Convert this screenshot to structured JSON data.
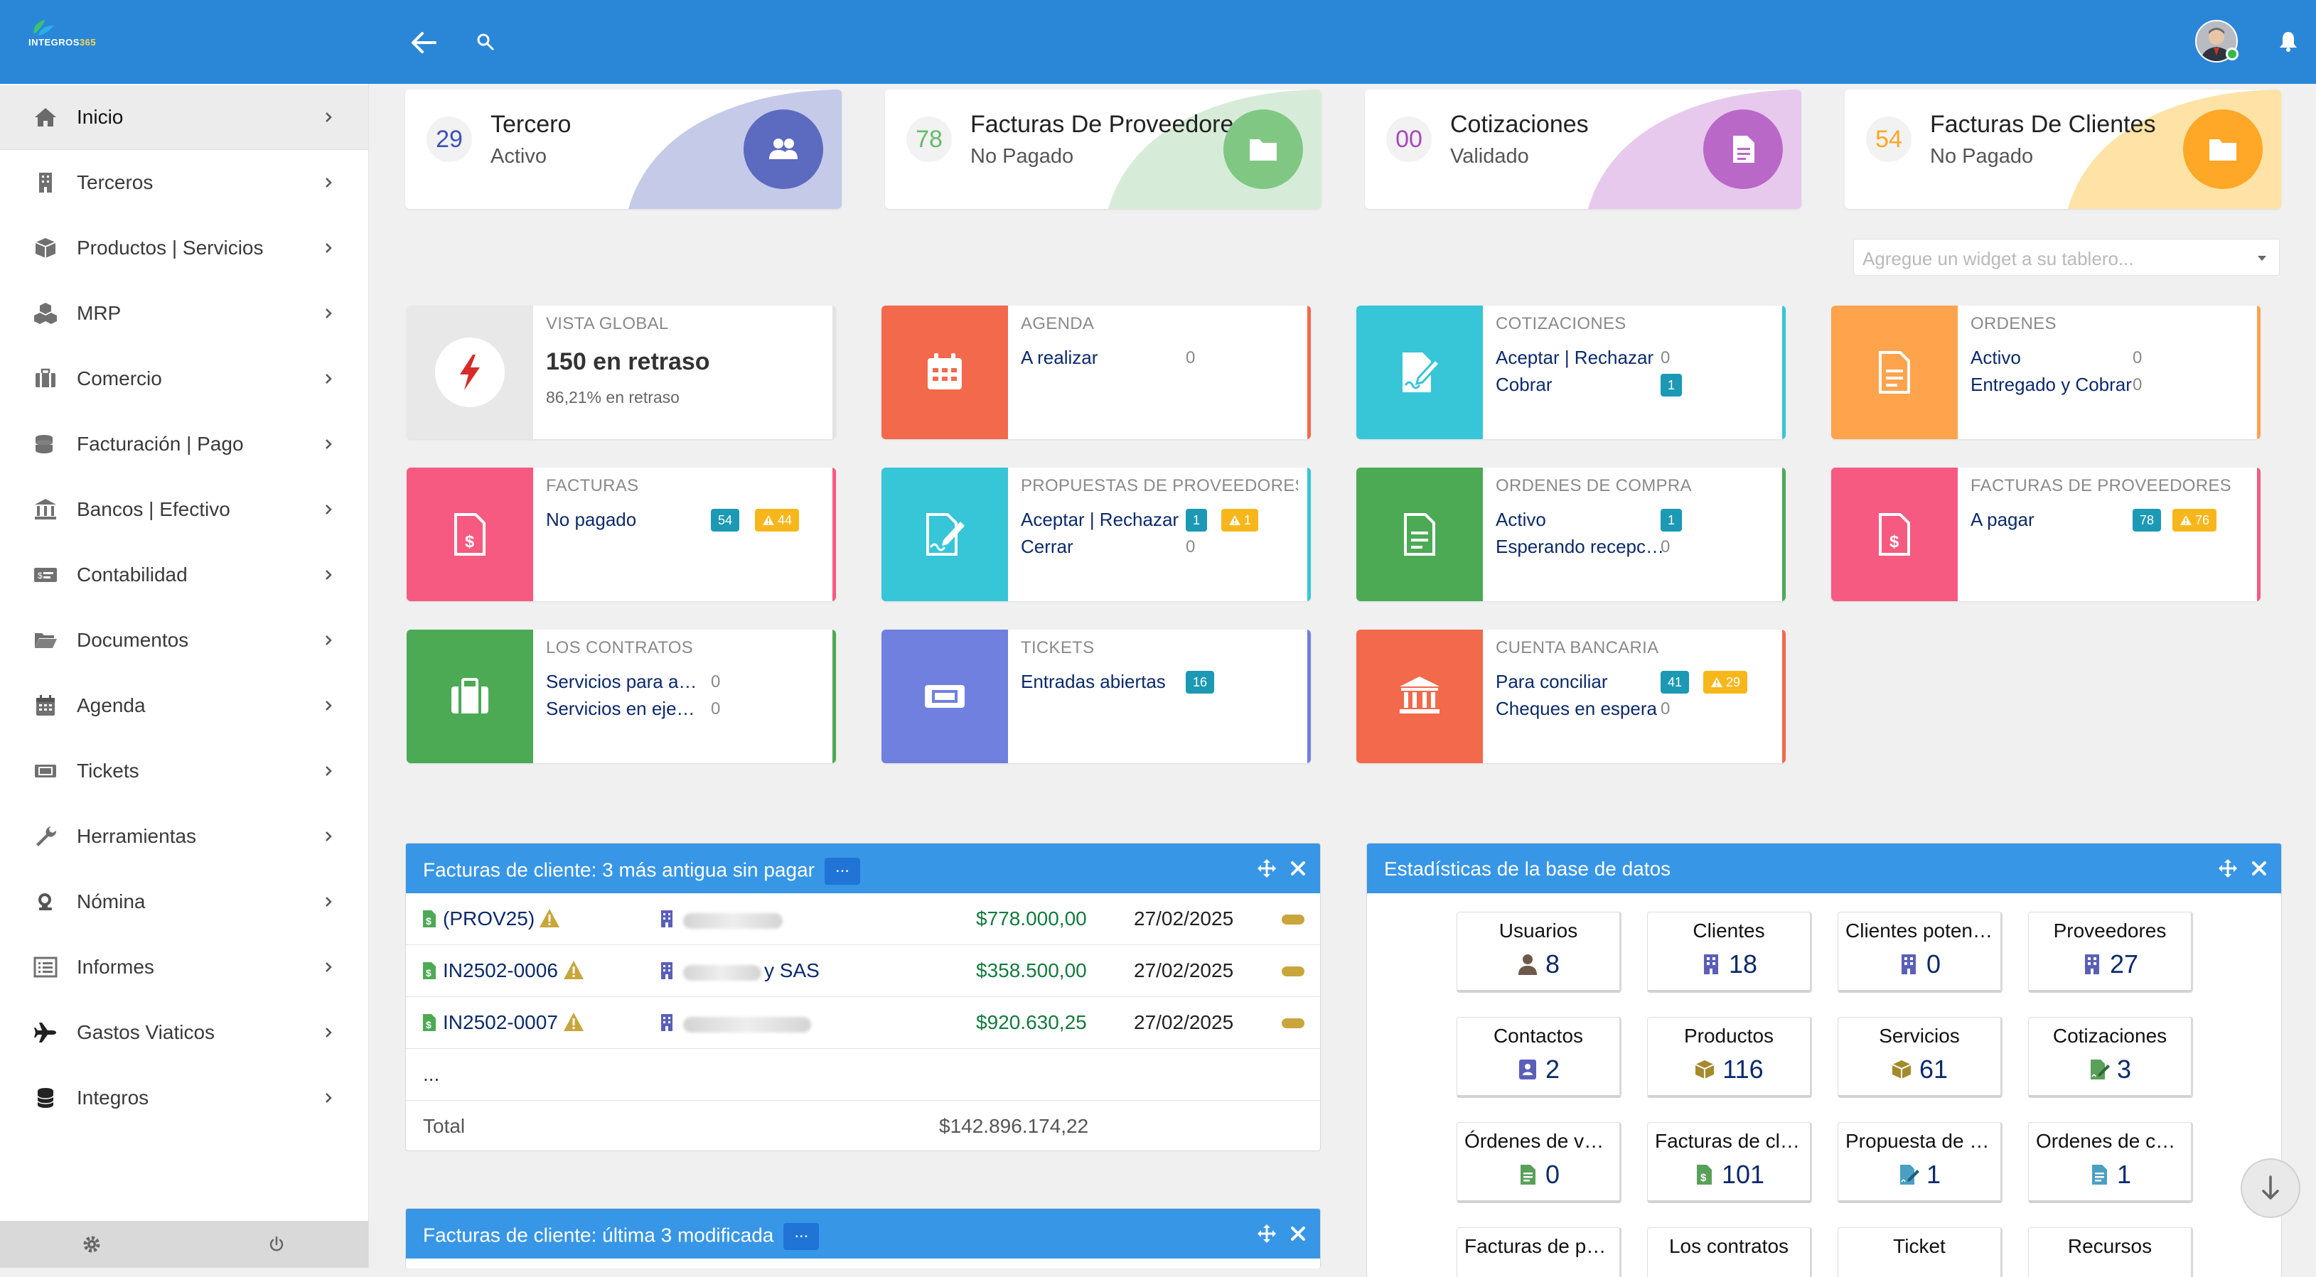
{
  "app": {
    "logo_text": "INTEGROS",
    "logo_suffix": "365"
  },
  "sidebar": {
    "items": [
      {
        "label": "Inicio",
        "icon": "home-icon"
      },
      {
        "label": "Terceros",
        "icon": "building-icon"
      },
      {
        "label": "Productos | Servicios",
        "icon": "cube-icon"
      },
      {
        "label": "MRP",
        "icon": "cubes-icon"
      },
      {
        "label": "Comercio",
        "icon": "suitcase-icon"
      },
      {
        "label": "Facturación | Pago",
        "icon": "coins-icon"
      },
      {
        "label": "Bancos | Efectivo",
        "icon": "bank-icon"
      },
      {
        "label": "Contabilidad",
        "icon": "money-check-icon"
      },
      {
        "label": "Documentos",
        "icon": "folder-open-icon"
      },
      {
        "label": "Agenda",
        "icon": "calendar-icon"
      },
      {
        "label": "Tickets",
        "icon": "ticket-icon"
      },
      {
        "label": "Herramientas",
        "icon": "wrench-icon"
      },
      {
        "label": "Nómina",
        "icon": "piggy-bank-icon"
      },
      {
        "label": "Informes",
        "icon": "list-icon"
      },
      {
        "label": "Gastos Viaticos",
        "icon": "plane-icon"
      },
      {
        "label": "Integros",
        "icon": "database-icon"
      }
    ]
  },
  "kpis": [
    {
      "number": "29",
      "title": "Tercero",
      "subtitle": "Activo",
      "color": "#5c6bc0",
      "wave": "#c5cae9",
      "numcolor": "#3f51b5"
    },
    {
      "number": "78",
      "title": "Facturas De Proveedores",
      "subtitle": "No Pagado",
      "color": "#81c784",
      "wave": "#d7ecd8",
      "numcolor": "#66bb6a"
    },
    {
      "number": "00",
      "title": "Cotizaciones",
      "subtitle": "Validado",
      "color": "#ba68c8",
      "wave": "#e8c9ee",
      "numcolor": "#ab47bc"
    },
    {
      "number": "54",
      "title": "Facturas De Clientes",
      "subtitle": "No Pagado",
      "color": "#ffa726",
      "wave": "#ffe3a6",
      "numcolor": "#ffa726"
    }
  ],
  "widget_select": {
    "placeholder": "Agregue un widget a su tablero..."
  },
  "boxes": {
    "global": {
      "title": "VISTA GLOBAL",
      "big": "150 en retraso",
      "sub": "86,21% en retraso"
    },
    "agenda": {
      "title": "AGENDA",
      "lines": [
        {
          "label": "A realizar",
          "count": "0"
        }
      ]
    },
    "cotizaciones": {
      "title": "COTIZACIONES",
      "lines": [
        {
          "label": "Aceptar | Rechazar",
          "count": "0"
        },
        {
          "label": "Cobrar",
          "badge": "1"
        }
      ]
    },
    "ordenes": {
      "title": "ORDENES",
      "lines": [
        {
          "label": "Activo",
          "count": "0"
        },
        {
          "label": "Entregado y Cobrar",
          "count": "0"
        }
      ]
    },
    "facturas": {
      "title": "FACTURAS",
      "lines": [
        {
          "label": "No pagado",
          "badge": "54",
          "warn": "44"
        }
      ]
    },
    "propuestas": {
      "title": "PROPUESTAS DE PROVEEDORES",
      "lines": [
        {
          "label": "Aceptar | Rechazar",
          "badge": "1",
          "warn": "1"
        },
        {
          "label": "Cerrar",
          "count": "0"
        }
      ]
    },
    "ordenes_compra": {
      "title": "ORDENES DE COMPRA",
      "lines": [
        {
          "label": "Activo",
          "badge": "1"
        },
        {
          "label": "Esperando recepción",
          "count": "0"
        }
      ]
    },
    "facturas_prov": {
      "title": "FACTURAS DE PROVEEDORES",
      "lines": [
        {
          "label": "A pagar",
          "badge": "78",
          "warn": "76"
        }
      ]
    },
    "contratos": {
      "title": "LOS CONTRATOS",
      "lines": [
        {
          "label": "Servicios para activar",
          "count": "0"
        },
        {
          "label": "Servicios en ejecución",
          "count": "0"
        }
      ]
    },
    "tickets": {
      "title": "TICKETS",
      "lines": [
        {
          "label": "Entradas abiertas",
          "badge": "16"
        }
      ]
    },
    "cuenta": {
      "title": "CUENTA BANCARIA",
      "lines": [
        {
          "label": "Para conciliar",
          "badge": "41",
          "warn": "29"
        },
        {
          "label": "Cheques en espera",
          "count": "0"
        }
      ]
    }
  },
  "invoices_panel": {
    "title": "Facturas de cliente: 3 más antigua sin pagar",
    "more": "...",
    "rows": [
      {
        "ref": "(PROV25)",
        "amount": "$778.000,00",
        "date": "27/02/2025"
      },
      {
        "ref": "IN2502-0006",
        "client_tail": "y SAS",
        "amount": "$358.500,00",
        "date": "27/02/2025"
      },
      {
        "ref": "IN2502-0007",
        "amount": "$920.630,25",
        "date": "27/02/2025"
      }
    ],
    "ellipsis": "...",
    "total_label": "Total",
    "total_value": "$142.896.174,22"
  },
  "modified_panel": {
    "title": "Facturas de cliente: última 3 modificada",
    "more": "..."
  },
  "stats_panel": {
    "title": "Estadísticas de la base de datos",
    "items": [
      {
        "label": "Usuarios",
        "value": "8",
        "icon": "user-icon",
        "color": "#6d5a49"
      },
      {
        "label": "Clientes",
        "value": "18",
        "icon": "building-icon",
        "color": "#5a5fb8"
      },
      {
        "label": "Clientes potenciales",
        "value": "0",
        "icon": "building-icon",
        "color": "#5a5fb8"
      },
      {
        "label": "Proveedores",
        "value": "27",
        "icon": "building-icon",
        "color": "#5a5fb8"
      },
      {
        "label": "Contactos",
        "value": "2",
        "icon": "address-book-icon",
        "color": "#5a5fb8"
      },
      {
        "label": "Productos",
        "value": "116",
        "icon": "cube-icon",
        "color": "#a58a2c"
      },
      {
        "label": "Servicios",
        "value": "61",
        "icon": "cube-icon",
        "color": "#a58a2c"
      },
      {
        "label": "Cotizaciones",
        "value": "3",
        "icon": "file-signature-icon",
        "color": "#5aa05a"
      },
      {
        "label": "Órdenes de venta",
        "value": "0",
        "icon": "file-text-icon",
        "color": "#5aa05a"
      },
      {
        "label": "Facturas de clientes",
        "value": "101",
        "icon": "file-invoice-icon",
        "color": "#5aa05a"
      },
      {
        "label": "Propuesta de proveedores",
        "value": "1",
        "icon": "file-signature-icon",
        "color": "#4a9fc2"
      },
      {
        "label": "Ordenes de compra",
        "value": "1",
        "icon": "file-text-icon",
        "color": "#4a9fc2"
      },
      {
        "label": "Facturas de proveedores",
        "value": "",
        "icon": "",
        "color": ""
      },
      {
        "label": "Los contratos",
        "value": "",
        "icon": "",
        "color": ""
      },
      {
        "label": "Ticket",
        "value": "",
        "icon": "",
        "color": ""
      },
      {
        "label": "Recursos",
        "value": "",
        "icon": "",
        "color": ""
      }
    ]
  },
  "colors": {
    "topbar": "#2a87d8",
    "panel_head": "#3796e6",
    "agenda": "#f2694c",
    "cotizaciones": "#37c5d8",
    "ordenes": "#ffa34d",
    "facturas": "#f65a80",
    "propuestas": "#37c5d8",
    "ordenes_compra": "#4caa55",
    "facturas_prov": "#f65a80",
    "contratos": "#4caa55",
    "tickets": "#6f80de",
    "cuenta": "#f2694c"
  }
}
